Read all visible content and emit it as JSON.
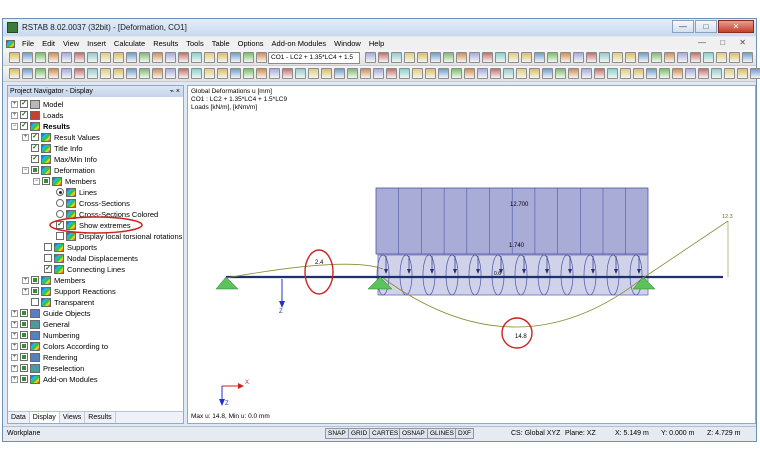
{
  "window": {
    "title": "RSTAB 8.02.0037 (32bit) - [Deformation, CO1]",
    "min_label": "—",
    "max_label": "□",
    "close_label": "✕",
    "mdi_controls": "— □ ✕"
  },
  "menu": [
    "File",
    "Edit",
    "View",
    "Insert",
    "Calculate",
    "Results",
    "Tools",
    "Table",
    "Options",
    "Add-on Modules",
    "Window",
    "Help"
  ],
  "toolbar": {
    "load_combo": "CO1 - LC2 + 1.35*LC4 + 1.5"
  },
  "navigator": {
    "title": "Project Navigator - Display",
    "pin": "⌁ ×",
    "items": [
      {
        "label": "Model"
      },
      {
        "label": "Loads"
      },
      {
        "label": "Results"
      },
      {
        "label": "Result Values"
      },
      {
        "label": "Title Info"
      },
      {
        "label": "Max/Min Info"
      },
      {
        "label": "Deformation"
      },
      {
        "label": "Members"
      },
      {
        "label": "Lines"
      },
      {
        "label": "Cross-Sections"
      },
      {
        "label": "Cross-Sections Colored"
      },
      {
        "label": "Show extremes"
      },
      {
        "label": "Display local torsional rotations"
      },
      {
        "label": "Supports"
      },
      {
        "label": "Nodal Displacements"
      },
      {
        "label": "Connecting Lines"
      },
      {
        "label": "Members"
      },
      {
        "label": "Support Reactions"
      },
      {
        "label": "Transparent"
      },
      {
        "label": "Guide Objects"
      },
      {
        "label": "General"
      },
      {
        "label": "Numbering"
      },
      {
        "label": "Colors According to"
      },
      {
        "label": "Rendering"
      },
      {
        "label": "Preselection"
      },
      {
        "label": "Add-on Modules"
      }
    ],
    "tabs": [
      "Data",
      "Display",
      "Views",
      "Results"
    ]
  },
  "view": {
    "line1": "Global Deformations u [mm]",
    "line2": "CO1 : LC2 + 1.35*LC4 + 1.5*LC9",
    "line3": "Loads [kN/m], [kNm/m]",
    "footer": "Max u: 14.8, Min u: 0.0 mm",
    "labels": {
      "top_load": "12.700",
      "mid_load": "1.740",
      "small_load": "0.6",
      "extreme_left": "2.4",
      "extreme_mid": "14.8",
      "extreme_right": "12.3",
      "axis_x": "X",
      "axis_z": "Z",
      "axis_z2": "Z"
    },
    "colors": {
      "load_fill": "#a9acd6",
      "load_stroke": "#4d55a8",
      "member": "#1d2f6e",
      "support": "#5cc35c",
      "highlight": "#cc2222",
      "deform": "#8b8a3a"
    }
  },
  "status": {
    "workplane": "Workplane",
    "buttons": [
      "SNAP",
      "GRID",
      "CARTES",
      "OSNAP",
      "GLINES",
      "DXF"
    ],
    "cs": "CS: Global XYZ",
    "plane": "Plane: XZ",
    "x": "X:  5.149 m",
    "y": "Y:  0.000 m",
    "z": "Z:  4.729 m"
  }
}
